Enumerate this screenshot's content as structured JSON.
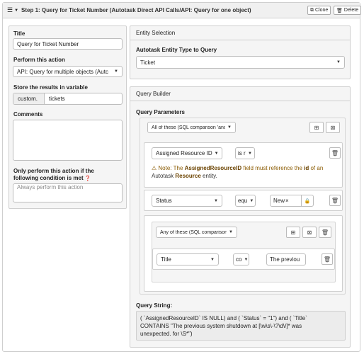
{
  "header": {
    "step_title": "Step 1: Query for Ticket Number (Autotask Direct API Calls/API: Query for one object)",
    "clone_label": "Clone",
    "delete_label": "Delete"
  },
  "left": {
    "title_label": "Title",
    "title_value": "Query for Ticket Number",
    "action_label": "Perform this action",
    "action_value": "API: Query for multiple objects (Autc",
    "store_label": "Store the results in variable",
    "store_prefix": "custom.",
    "store_value": "tickets",
    "comments_label": "Comments",
    "comments_value": "",
    "condition_label_1": "Only perform this action if the",
    "condition_label_2": "following condition is met",
    "condition_placeholder": "Always perform this action"
  },
  "entity": {
    "section_title": "Entity Selection",
    "type_label": "Autotask Entity Type to Query",
    "type_value": "Ticket"
  },
  "query_builder": {
    "section_title": "Query Builder",
    "params_label": "Query Parameters",
    "group_select": "All of these (SQL comparison 'anc",
    "row1": {
      "field": "Assigned Resource ID",
      "op": "is r",
      "note_prefix": "Note: The ",
      "note_field": "AssignedResourceID",
      "note_mid": " field must reference the ",
      "note_id": "id",
      "note_of": " of an",
      "note_line2_pre": "Autotask ",
      "note_resource": "Resource",
      "note_end": " entity."
    },
    "row2": {
      "field": "Status",
      "op": "equ",
      "value_tag": "New",
      "value_tag_remove": "×"
    },
    "subgroup": {
      "group_select": "Any of these (SQL comparison",
      "field": "Title",
      "op": "co",
      "value": "The previou"
    },
    "query_string_label": "Query String:",
    "query_string_line1": "( `AssignedResourceID` IS NULL) and ( `Status` = \"1\") and ( `Title`",
    "query_string_line2": "CONTAINS \"The previous system shutdown at [\\w\\s\\-\\?\\d\\/]* was",
    "query_string_line3": "unexpected. for \\S*\")"
  },
  "icons": {
    "hamburger": "hamburger-icon",
    "clone": "copy-icon",
    "delete": "trash-icon",
    "help": "help-circle-icon",
    "warning": "warning-icon",
    "lock": "lock-icon",
    "add_rule": "add-rule-icon",
    "add_group": "add-group-icon"
  }
}
